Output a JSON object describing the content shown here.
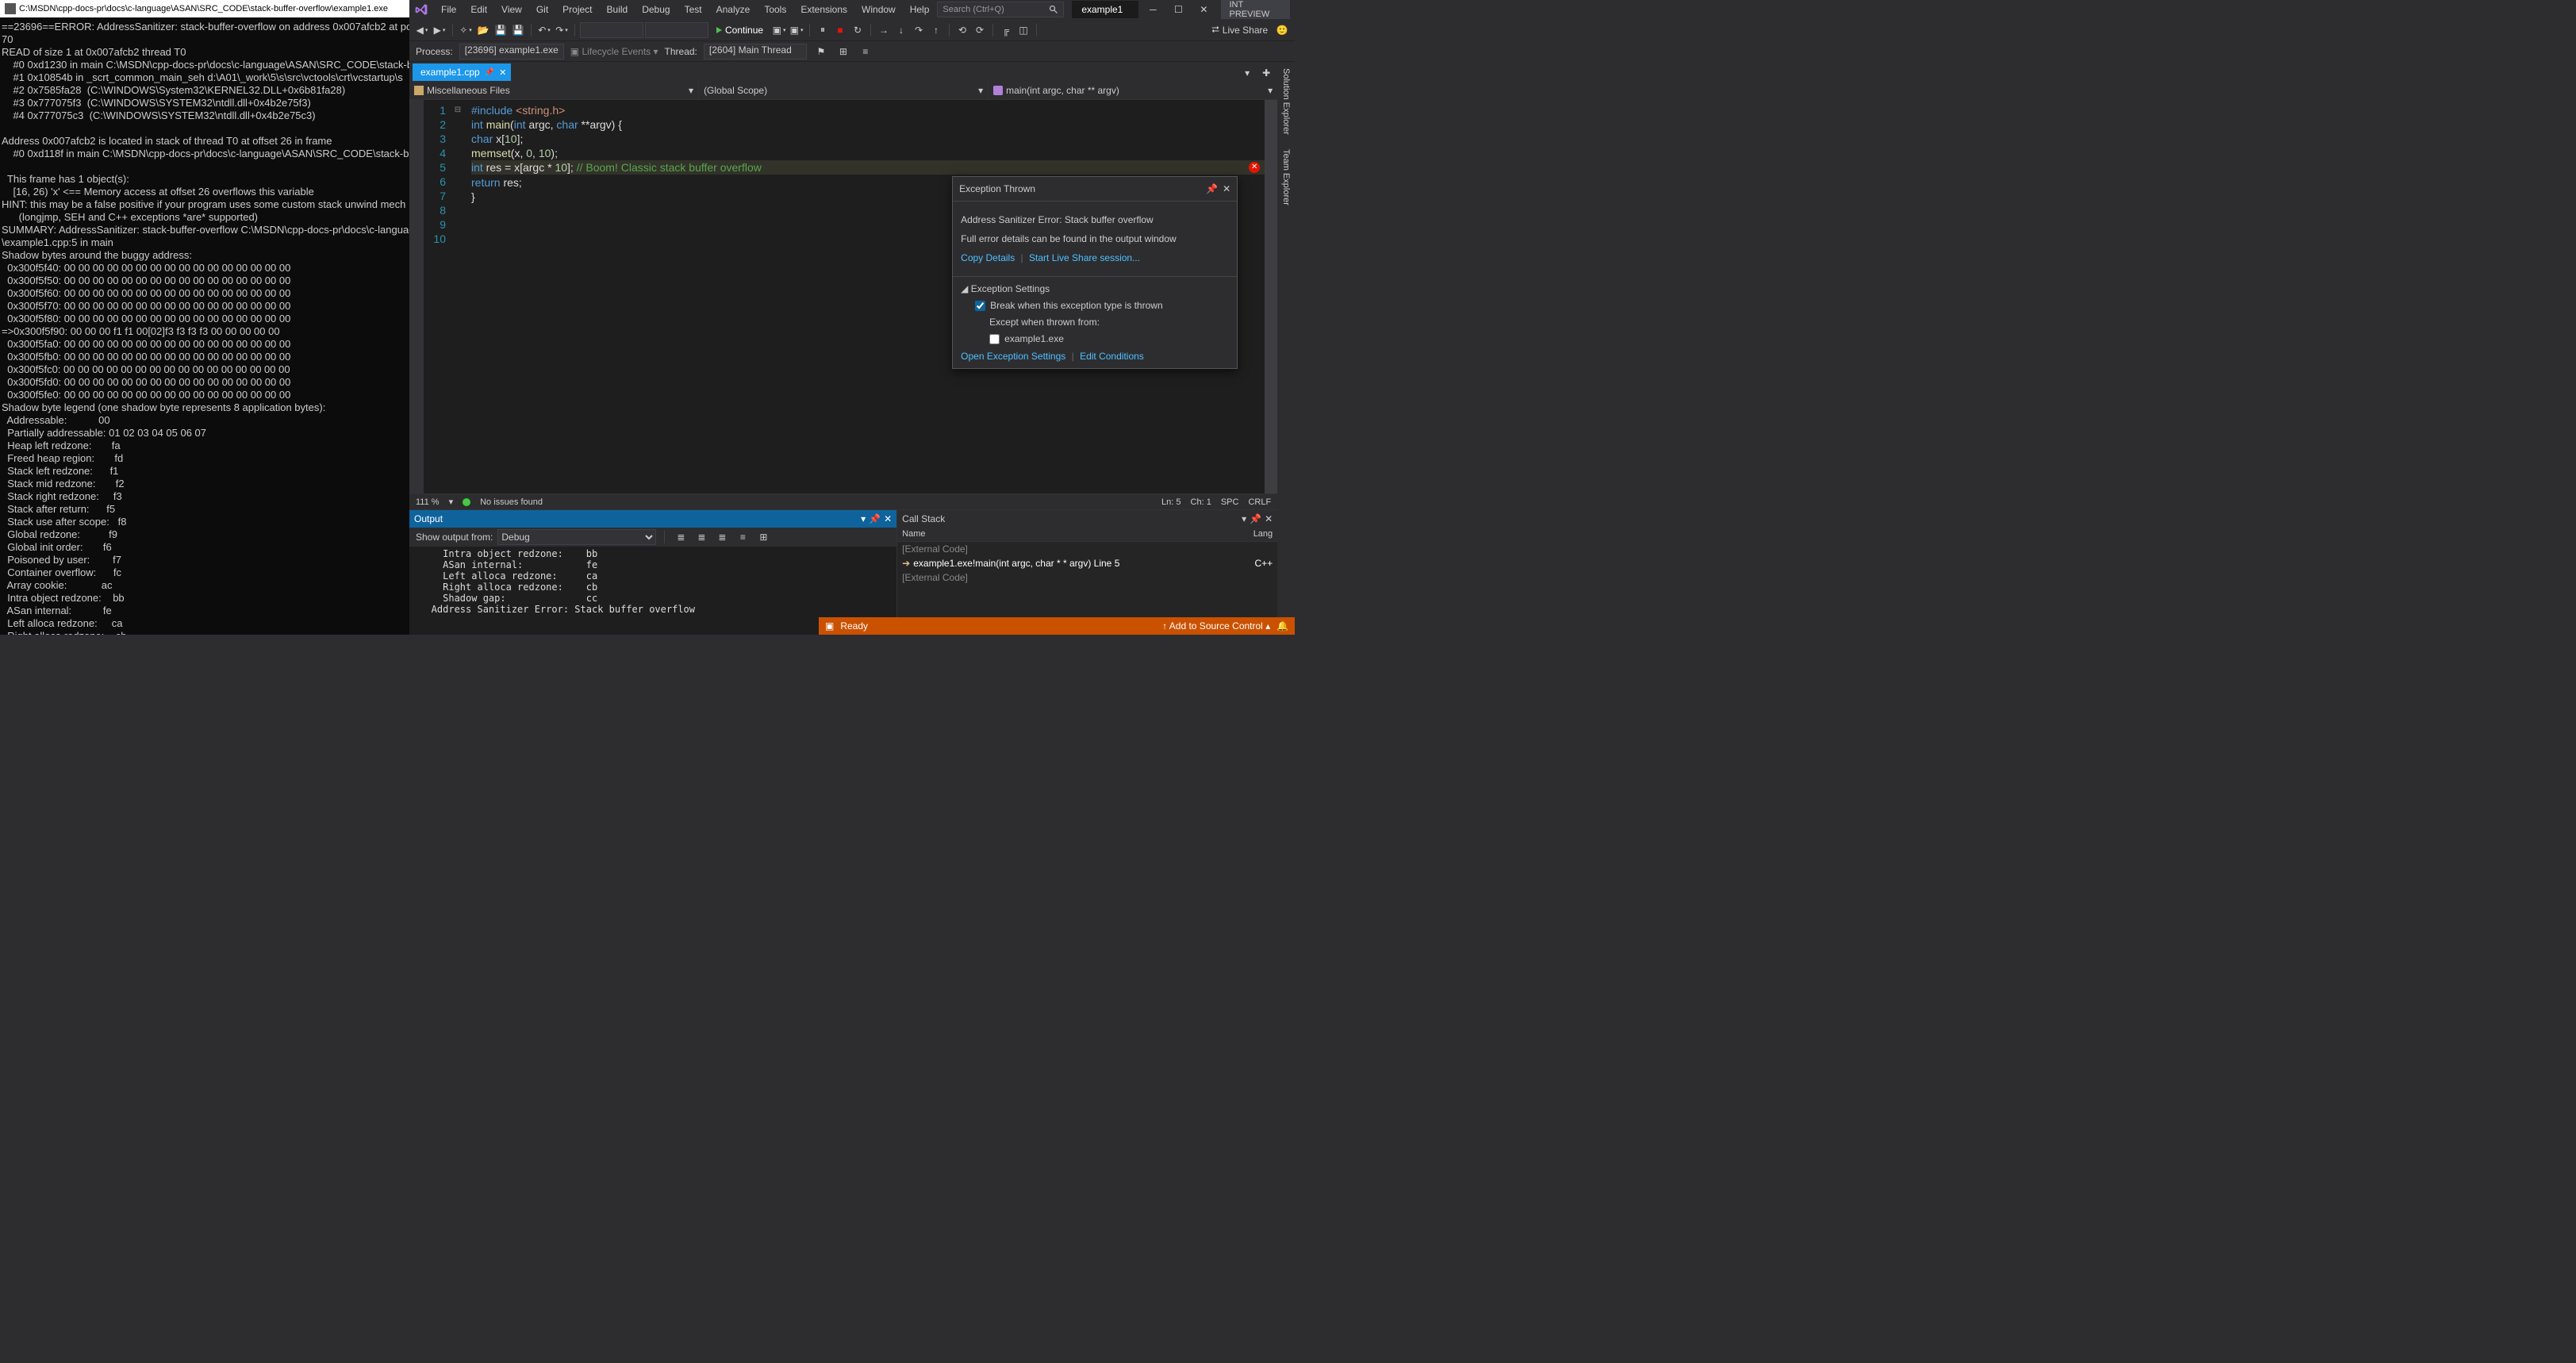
{
  "console": {
    "title": "C:\\MSDN\\cpp-docs-pr\\docs\\c-language\\ASAN\\SRC_CODE\\stack-buffer-overflow\\example1.exe",
    "body": "==23696==ERROR: AddressSanitizer: stack-buffer-overflow on address 0x007afcb2 at pc 0\n70\nREAD of size 1 at 0x007afcb2 thread T0\n    #0 0xd1230 in main C:\\MSDN\\cpp-docs-pr\\docs\\c-language\\ASAN\\SRC_CODE\\stack-buffer\n    #1 0x10854b in _scrt_common_main_seh d:\\A01\\_work\\5\\s\\src\\vctools\\crt\\vcstartup\\s\n    #2 0x7585fa28  (C:\\WINDOWS\\System32\\KERNEL32.DLL+0x6b81fa28)\n    #3 0x777075f3  (C:\\WINDOWS\\SYSTEM32\\ntdll.dll+0x4b2e75f3)\n    #4 0x777075c3  (C:\\WINDOWS\\SYSTEM32\\ntdll.dll+0x4b2e75c3)\n\nAddress 0x007afcb2 is located in stack of thread T0 at offset 26 in frame\n    #0 0xd118f in main C:\\MSDN\\cpp-docs-pr\\docs\\c-language\\ASAN\\SRC_CODE\\stack-buffer\n\n  This frame has 1 object(s):\n    [16, 26) 'x' <== Memory access at offset 26 overflows this variable\nHINT: this may be a false positive if your program uses some custom stack unwind mech\n      (longjmp, SEH and C++ exceptions *are* supported)\nSUMMARY: AddressSanitizer: stack-buffer-overflow C:\\MSDN\\cpp-docs-pr\\docs\\c-language\\\n\\example1.cpp:5 in main\nShadow bytes around the buggy address:\n  0x300f5f40: 00 00 00 00 00 00 00 00 00 00 00 00 00 00 00 00\n  0x300f5f50: 00 00 00 00 00 00 00 00 00 00 00 00 00 00 00 00\n  0x300f5f60: 00 00 00 00 00 00 00 00 00 00 00 00 00 00 00 00\n  0x300f5f70: 00 00 00 00 00 00 00 00 00 00 00 00 00 00 00 00\n  0x300f5f80: 00 00 00 00 00 00 00 00 00 00 00 00 00 00 00 00\n=>0x300f5f90: 00 00 00 f1 f1 00[02]f3 f3 f3 f3 00 00 00 00 00\n  0x300f5fa0: 00 00 00 00 00 00 00 00 00 00 00 00 00 00 00 00\n  0x300f5fb0: 00 00 00 00 00 00 00 00 00 00 00 00 00 00 00 00\n  0x300f5fc0: 00 00 00 00 00 00 00 00 00 00 00 00 00 00 00 00\n  0x300f5fd0: 00 00 00 00 00 00 00 00 00 00 00 00 00 00 00 00\n  0x300f5fe0: 00 00 00 00 00 00 00 00 00 00 00 00 00 00 00 00\nShadow byte legend (one shadow byte represents 8 application bytes):\n  Addressable:           00\n  Partially addressable: 01 02 03 04 05 06 07\n  Heap left redzone:       fa\n  Freed heap region:       fd\n  Stack left redzone:      f1\n  Stack mid redzone:       f2\n  Stack right redzone:     f3\n  Stack after return:      f5\n  Stack use after scope:   f8\n  Global redzone:          f9\n  Global init order:       f6\n  Poisoned by user:        f7\n  Container overflow:      fc\n  Array cookie:            ac\n  Intra object redzone:    bb\n  ASan internal:           fe\n  Left alloca redzone:     ca\n  Right alloca redzone:    cb\n  Shadow gap:              cc"
  },
  "menu": [
    "File",
    "Edit",
    "View",
    "Git",
    "Project",
    "Build",
    "Debug",
    "Test",
    "Analyze",
    "Tools",
    "Extensions",
    "Window",
    "Help"
  ],
  "search_placeholder": "Search (Ctrl+Q)",
  "solution_name": "example1",
  "int_preview": "INT PREVIEW",
  "toolbar": {
    "continue": "Continue",
    "liveshare": "Live Share"
  },
  "debugbar": {
    "process_label": "Process:",
    "process_value": "[23696] example1.exe",
    "lifecycle": "Lifecycle Events",
    "thread_label": "Thread:",
    "thread_value": "[2604] Main Thread"
  },
  "tab_name": "example1.cpp",
  "nav": {
    "left": "Miscellaneous Files",
    "mid": "(Global Scope)",
    "right": "main(int argc, char ** argv)"
  },
  "code": {
    "lines": [
      "1",
      "2",
      "3",
      "4",
      "5",
      "6",
      "7",
      "8",
      "9",
      "10"
    ]
  },
  "ed_status": {
    "zoom": "111 %",
    "issues": "No issues found",
    "ln": "Ln: 5",
    "ch": "Ch: 1",
    "spc": "SPC",
    "crlf": "CRLF"
  },
  "side_tabs": [
    "Solution Explorer",
    "Team Explorer"
  ],
  "output": {
    "title": "Output",
    "show_from": "Show output from:",
    "source": "Debug",
    "body": "     Intra object redzone:    bb\n     ASan internal:           fe\n     Left alloca redzone:     ca\n     Right alloca redzone:    cb\n     Shadow gap:              cc\n   Address Sanitizer Error: Stack buffer overflow"
  },
  "callstack": {
    "title": "Call Stack",
    "col_name": "Name",
    "col_lang": "Lang",
    "rows": [
      {
        "text": "[External Code]",
        "active": false
      },
      {
        "text": "example1.exe!main(int argc, char * * argv) Line 5",
        "lang": "C++",
        "active": true
      },
      {
        "text": "[External Code]",
        "active": false
      }
    ]
  },
  "exception": {
    "title": "Exception Thrown",
    "message": "Address Sanitizer Error: Stack buffer overflow",
    "details": "Full error details can be found in the output window",
    "copy": "Copy Details",
    "start_ls": "Start Live Share session...",
    "settings_title": "Exception Settings",
    "break_label": "Break when this exception type is thrown",
    "except_label": "Except when thrown from:",
    "module": "example1.exe",
    "open_settings": "Open Exception Settings",
    "edit_cond": "Edit Conditions"
  },
  "statusbar": {
    "ready": "Ready",
    "source_control": "Add to Source Control"
  }
}
